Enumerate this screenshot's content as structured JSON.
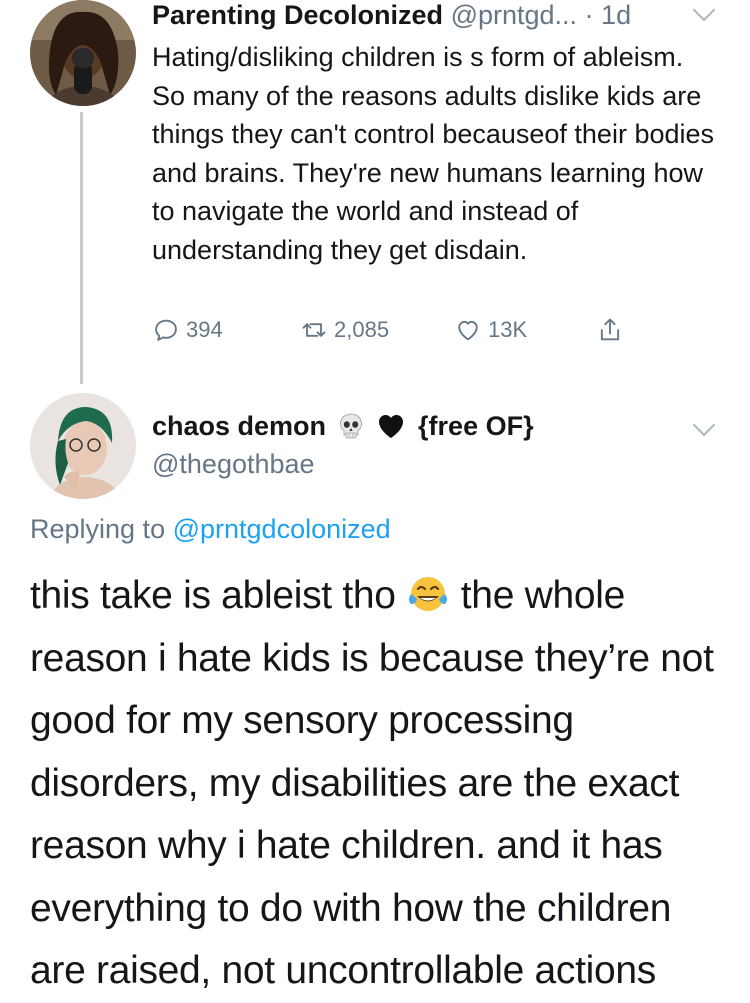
{
  "tweet1": {
    "display_name": "Parenting Decolonized",
    "handle": "@prntgd...",
    "time": "· 1d",
    "text": "Hating/disliking children is s form of ableism. So many of the reasons adults dislike kids are things they can't control becauseof their bodies and brains. They're new humans learning how to navigate the world and instead of understanding they get disdain.",
    "actions": {
      "reply_count": "394",
      "retweet_count": "2,085",
      "like_count": "13K"
    }
  },
  "tweet2": {
    "display_name": "chaos demon",
    "display_name_suffix": "{free OF}",
    "handle": "@thegothbae",
    "replying_prefix": "Replying to",
    "replying_handle": "@prntgdcolonized",
    "text_part1": "this take is ableist tho",
    "text_part2": "the whole reason i hate kids is because they’re not good for my sensory processing disorders, my disabilities are the exact reason why i hate children. and it has everything to do with how the children are raised, not uncontrollable actions"
  },
  "colors": {
    "text": "#14171a",
    "secondary": "#657786",
    "link": "#1da1f2",
    "thread_line": "#c4ccd3"
  }
}
